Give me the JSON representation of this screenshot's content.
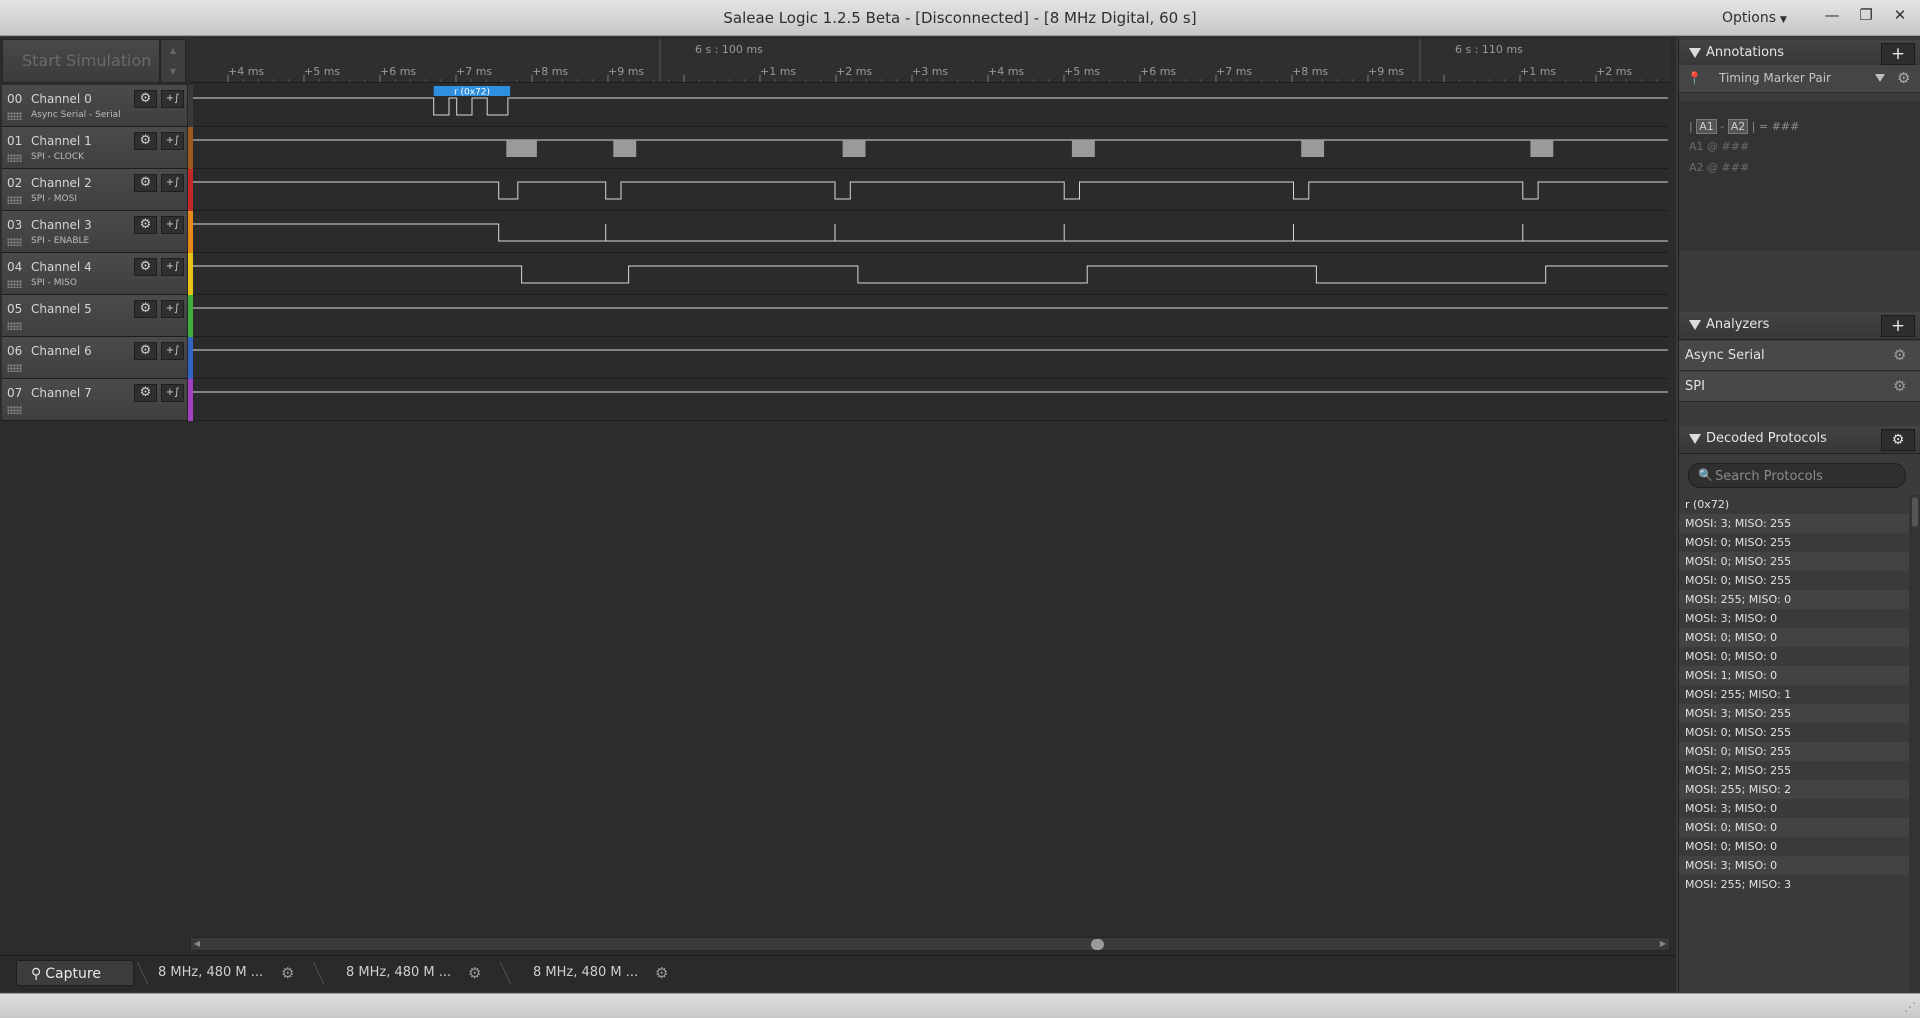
{
  "window": {
    "title": "Saleae Logic 1.2.5 Beta - [Disconnected] - [8 MHz Digital, 60 s]",
    "options_label": "Options",
    "minimize_glyph": "—",
    "restore_glyph": "❐",
    "close_glyph": "✕"
  },
  "toolbar": {
    "start_label": "Start Simulation"
  },
  "ruler": {
    "majors": [
      "6 s : 100 ms",
      "6 s : 110 ms"
    ],
    "ticks": [
      "+4 ms",
      "+5 ms",
      "+6 ms",
      "+7 ms",
      "+8 ms",
      "+9 ms",
      "+1 ms",
      "+2 ms",
      "+3 ms",
      "+4 ms",
      "+5 ms",
      "+6 ms",
      "+7 ms",
      "+8 ms",
      "+9 ms",
      "+1 ms",
      "+2 ms"
    ]
  },
  "channels": [
    {
      "num": "00",
      "name": "Channel 0",
      "sub": "Async Serial - Serial",
      "color": "#3a3a3a"
    },
    {
      "num": "01",
      "name": "Channel 1",
      "sub": "SPI - CLOCK",
      "color": "#9b5a1e"
    },
    {
      "num": "02",
      "name": "Channel 2",
      "sub": "SPI - MOSI",
      "color": "#c0282a"
    },
    {
      "num": "03",
      "name": "Channel 3",
      "sub": "SPI - ENABLE",
      "color": "#e68a1c"
    },
    {
      "num": "04",
      "name": "Channel 4",
      "sub": "SPI - MISO",
      "color": "#e5c319"
    },
    {
      "num": "05",
      "name": "Channel 5",
      "sub": "",
      "color": "#3fae3a"
    },
    {
      "num": "06",
      "name": "Channel 6",
      "sub": "",
      "color": "#3463c4"
    },
    {
      "num": "07",
      "name": "Channel 7",
      "sub": "",
      "color": "#a23fc2"
    }
  ],
  "waveforms": {
    "time_start_ms": 3.6,
    "time_end_ms": 22.9,
    "ch0": {
      "idle": "high",
      "edges": [
        6.75,
        6.95,
        7.05,
        7.25,
        7.45,
        7.72
      ],
      "frame_label": "r (0x72)",
      "frame_start": 6.75,
      "frame_end": 7.75
    },
    "ch1": {
      "bursts": [
        [
          7.7,
          8.1
        ],
        [
          9.1,
          9.4
        ],
        [
          12.1,
          12.4
        ],
        [
          15.1,
          15.4
        ],
        [
          18.1,
          18.4
        ],
        [
          21.1,
          21.4
        ]
      ]
    },
    "ch2": {
      "idle": "high",
      "edges": [
        7.6,
        7.85,
        9.0,
        9.2,
        12.0,
        12.2,
        15.0,
        15.2,
        18.0,
        18.2,
        21.0,
        21.2
      ]
    },
    "ch3": {
      "idle": "high",
      "edges": [
        7.6
      ],
      "spikes": [
        9.0,
        12.0,
        15.0,
        18.0,
        21.0
      ]
    },
    "ch4": {
      "idle": "high",
      "edges": [
        7.9,
        9.3,
        12.3,
        15.3,
        18.3,
        21.3
      ]
    },
    "ch5": {
      "idle": "high"
    },
    "ch6": {
      "idle": "high"
    },
    "ch7": {
      "idle": "high"
    }
  },
  "tabs": {
    "capture_label": "Capture",
    "session_labels": [
      "8 MHz, 480 M ...",
      "8 MHz, 480 M ...",
      "8 MHz, 480 M ..."
    ]
  },
  "annotations": {
    "title": "Annotations",
    "marker_name": "Timing Marker Pair",
    "a1": "A1",
    "a2": "A2",
    "dash": "-",
    "bar": "|",
    "equals_value": "= ###",
    "a1_line": "A1  @  ###",
    "a2_line": "A2  @  ###"
  },
  "analyzers": {
    "title": "Analyzers",
    "items": [
      "Async Serial",
      "SPI"
    ]
  },
  "decoded": {
    "title": "Decoded Protocols",
    "search_placeholder": "Search Protocols",
    "items": [
      "r (0x72)",
      "MOSI: 3;  MISO: 255",
      "MOSI: 0;  MISO: 255",
      "MOSI: 0;  MISO: 255",
      "MOSI: 0;  MISO: 255",
      "MOSI: 255;  MISO: 0",
      "MOSI: 3;  MISO: 0",
      "MOSI: 0;  MISO: 0",
      "MOSI: 0;  MISO: 0",
      "MOSI: 1;  MISO: 0",
      "MOSI: 255;  MISO: 1",
      "MOSI: 3;  MISO: 255",
      "MOSI: 0;  MISO: 255",
      "MOSI: 0;  MISO: 255",
      "MOSI: 2;  MISO: 255",
      "MOSI: 255;  MISO: 2",
      "MOSI: 3;  MISO: 0",
      "MOSI: 0;  MISO: 0",
      "MOSI: 0;  MISO: 0",
      "MOSI: 3;  MISO: 0",
      "MOSI: 255;  MISO: 3"
    ]
  },
  "icons": {
    "gear": "gear-icon",
    "trigger": "trigger-icon",
    "add": "plus-icon",
    "search": "search-icon",
    "capture": "capture-icon"
  }
}
